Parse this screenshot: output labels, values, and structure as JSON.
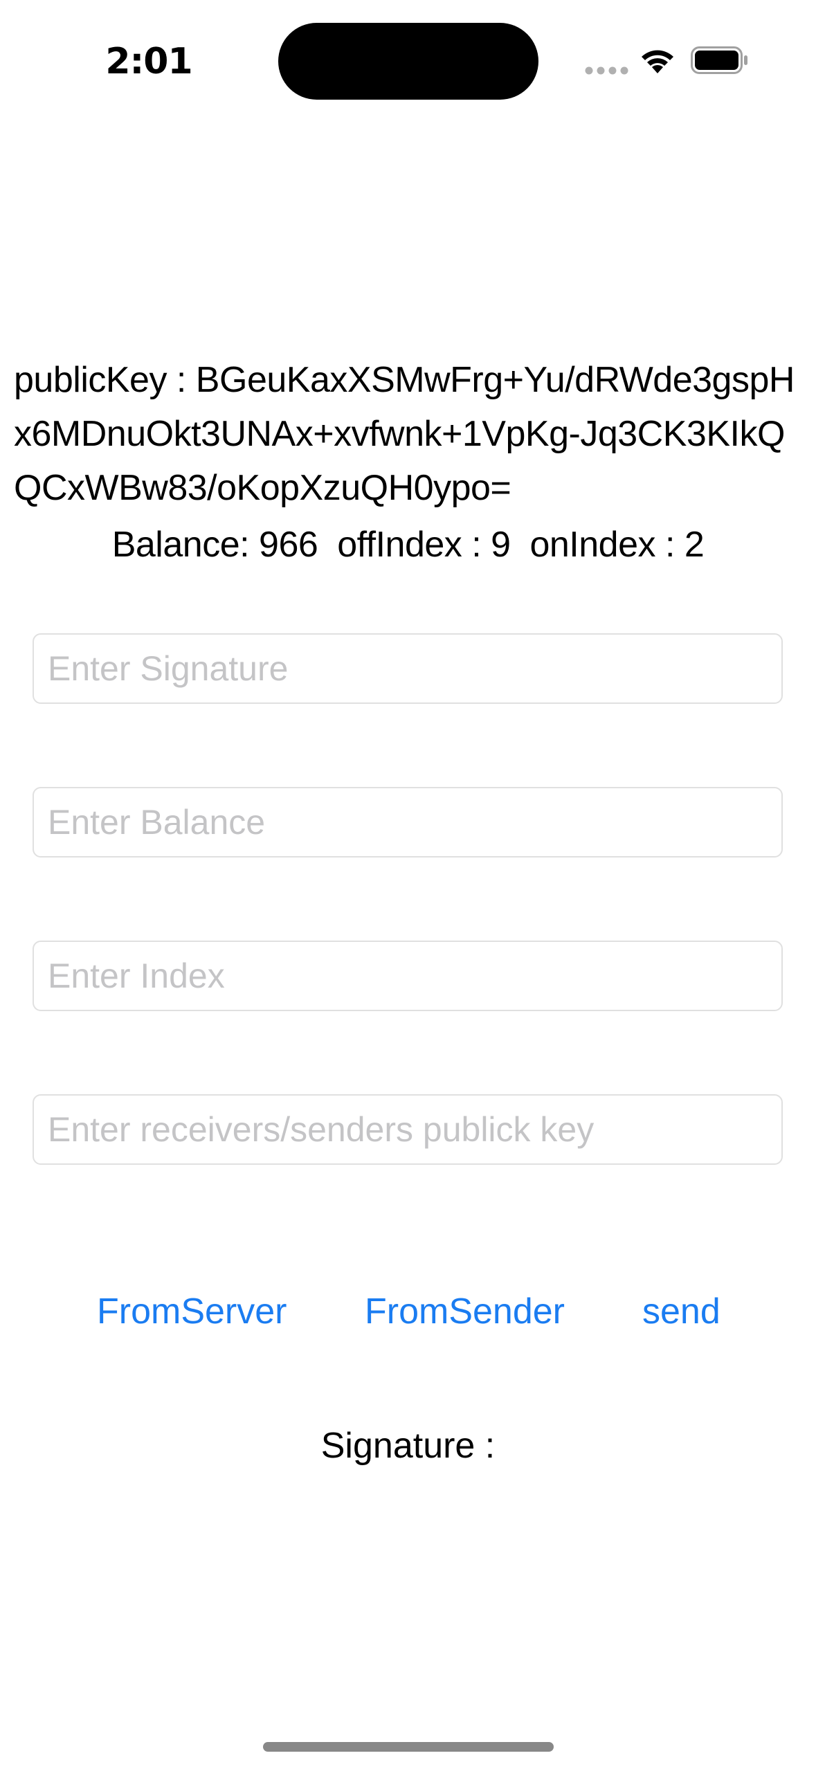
{
  "status_bar": {
    "time": "2:01"
  },
  "info": {
    "public_key_text": "publicKey : BGeuKaxXSMwFrg+Yu/dRWde3gspHx6MDnuOkt3UNAx+xvfwnk+1VpKg-Jq3CK3KIkQQCxWBw83/oKopXzuQH0ypo=",
    "balance_label": "Balance:",
    "balance_value": "966",
    "off_index_label": "offIndex :",
    "off_index_value": "9",
    "on_index_label": "onIndex :",
    "on_index_value": "2"
  },
  "inputs": {
    "signature_placeholder": "Enter Signature",
    "balance_placeholder": "Enter Balance",
    "index_placeholder": "Enter Index",
    "pubkey_placeholder": "Enter receivers/senders publick key",
    "signature_value": "",
    "balance_value": "",
    "index_value": "",
    "pubkey_value": ""
  },
  "buttons": {
    "from_server": "FromServer",
    "from_sender": "FromSender",
    "send": "send"
  },
  "result": {
    "signature_label": "Signature :"
  },
  "colors": {
    "accent": "#1a7cf1",
    "placeholder": "#c4c4c6",
    "border": "#e0e0e0"
  },
  "icons": [
    "signal-dots-icon",
    "wifi-icon",
    "battery-icon"
  ]
}
